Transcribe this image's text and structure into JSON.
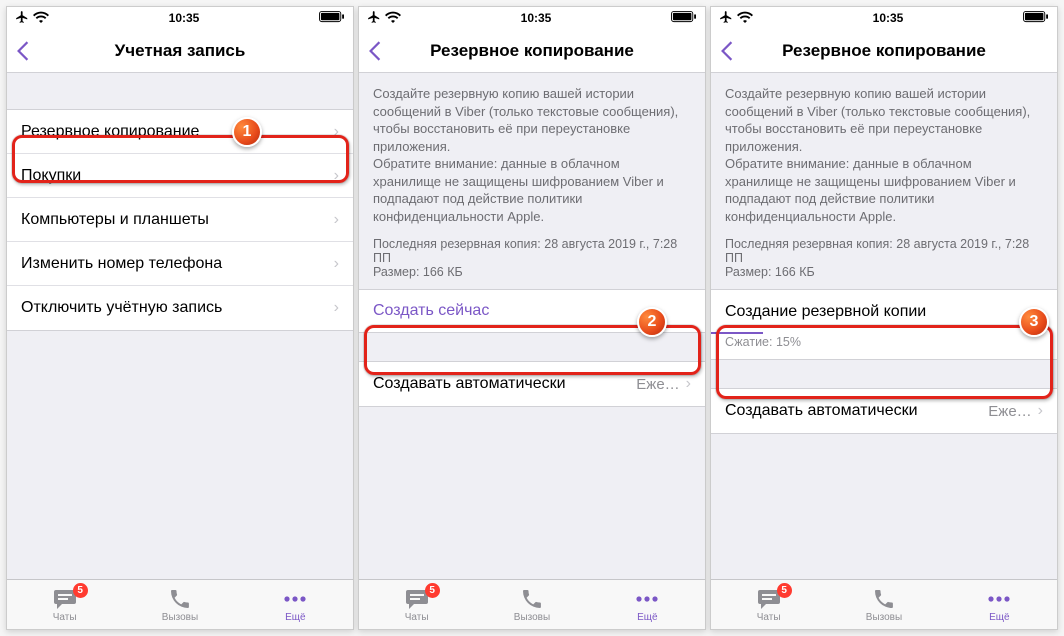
{
  "status": {
    "time": "10:35"
  },
  "panel1": {
    "title": "Учетная запись",
    "rows": [
      "Резервное копирование",
      "Покупки",
      "Компьютеры и планшеты",
      "Изменить номер телефона",
      "Отключить учётную запись"
    ]
  },
  "panel2": {
    "title": "Резервное копирование",
    "info": "Создайте резервную копию вашей истории сообщений в Viber (только текстовые сообщения), чтобы восстановить её при переустановке приложения.\nОбратите внимание: данные в облачном хранилище не защищены шифрованием Viber и подпадают под действие политики конфиденциальности Apple.",
    "meta_line1": "Последняя резервная копия: 28 августа 2019 г., 7:28 ПП",
    "meta_line2": "Размер: 166 КБ",
    "action": "Создать сейчас",
    "auto_label": "Создавать автоматически",
    "auto_value": "Еже…"
  },
  "panel3": {
    "title": "Резервное копирование",
    "info": "Создайте резервную копию вашей истории сообщений в Viber (только текстовые сообщения), чтобы восстановить её при переустановке приложения.\nОбратите внимание: данные в облачном хранилище не защищены шифрованием Viber и подпадают под действие политики конфиденциальности Apple.",
    "meta_line1": "Последняя резервная копия: 28 августа 2019 г., 7:28 ПП",
    "meta_line2": "Размер: 166 КБ",
    "busy_label": "Создание резервной копии",
    "progress_label": "Сжатие: 15%",
    "auto_label": "Создавать автоматически",
    "auto_value": "Еже…"
  },
  "tabs": {
    "chats": "Чаты",
    "calls": "Вызовы",
    "more": "Ещё",
    "badge": "5"
  },
  "callouts": {
    "c1": "1",
    "c2": "2",
    "c3": "3"
  }
}
